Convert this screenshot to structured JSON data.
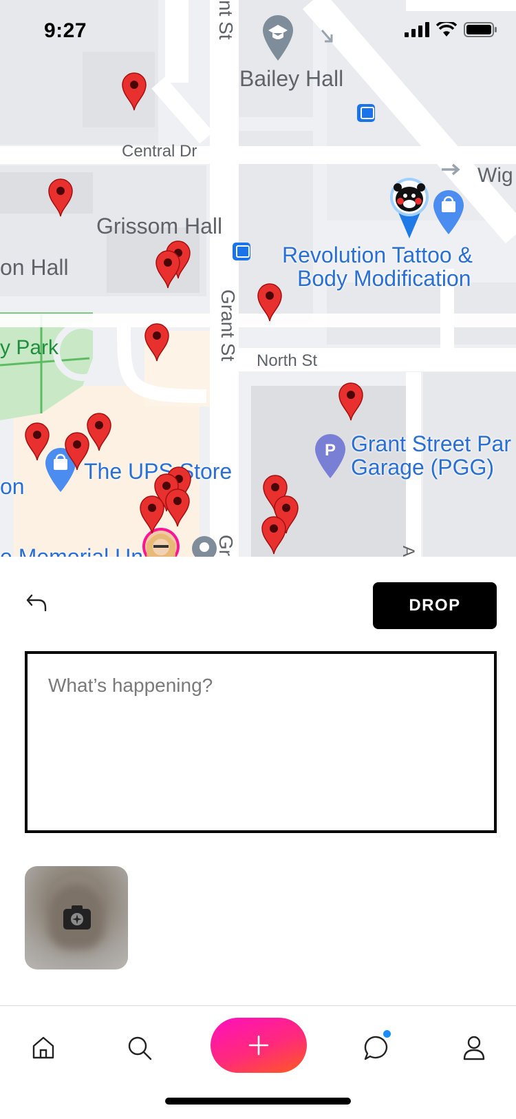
{
  "status_bar": {
    "time": "9:27"
  },
  "map": {
    "places": {
      "bailey_hall": "Bailey Hall",
      "grissom_hall": "Grissom Hall",
      "on_hall": "on Hall",
      "park": "y Park",
      "ups_store": "The UPS Store",
      "on_left": "on",
      "memorial": "e Memorial Un",
      "revolution_1": "Revolution Tattoo &",
      "revolution_2": "Body Modification",
      "garage_1": "Grant Street Par",
      "garage_2": "Garage (PGG)",
      "wig": "Wig"
    },
    "streets": {
      "central_dr": "Central Dr",
      "north_st": "North St",
      "grant_st": "Grant St",
      "grant_st_top": "nt St",
      "gr_bottom": "Gr",
      "a_bottom": "A"
    },
    "colors": {
      "pin": "#e8312f",
      "pin_dark": "#a30f0f",
      "poi_blue": "#4a8cf0",
      "poi_gray": "#7f8c99",
      "park": "#c8e8c6"
    },
    "parking_icon": "P"
  },
  "composer": {
    "back_icon": "undo-arrow-icon",
    "drop_label": "DROP",
    "placeholder": "What’s happening?",
    "camera_icon": "camera-icon"
  },
  "tabbar": {
    "items": [
      "home-icon",
      "search-icon",
      "create-plus-icon",
      "chat-bubble-icon",
      "profile-icon"
    ],
    "chat_has_notification": true,
    "fab_gradient": [
      "#ff0fbe",
      "#ff5a1f"
    ]
  }
}
